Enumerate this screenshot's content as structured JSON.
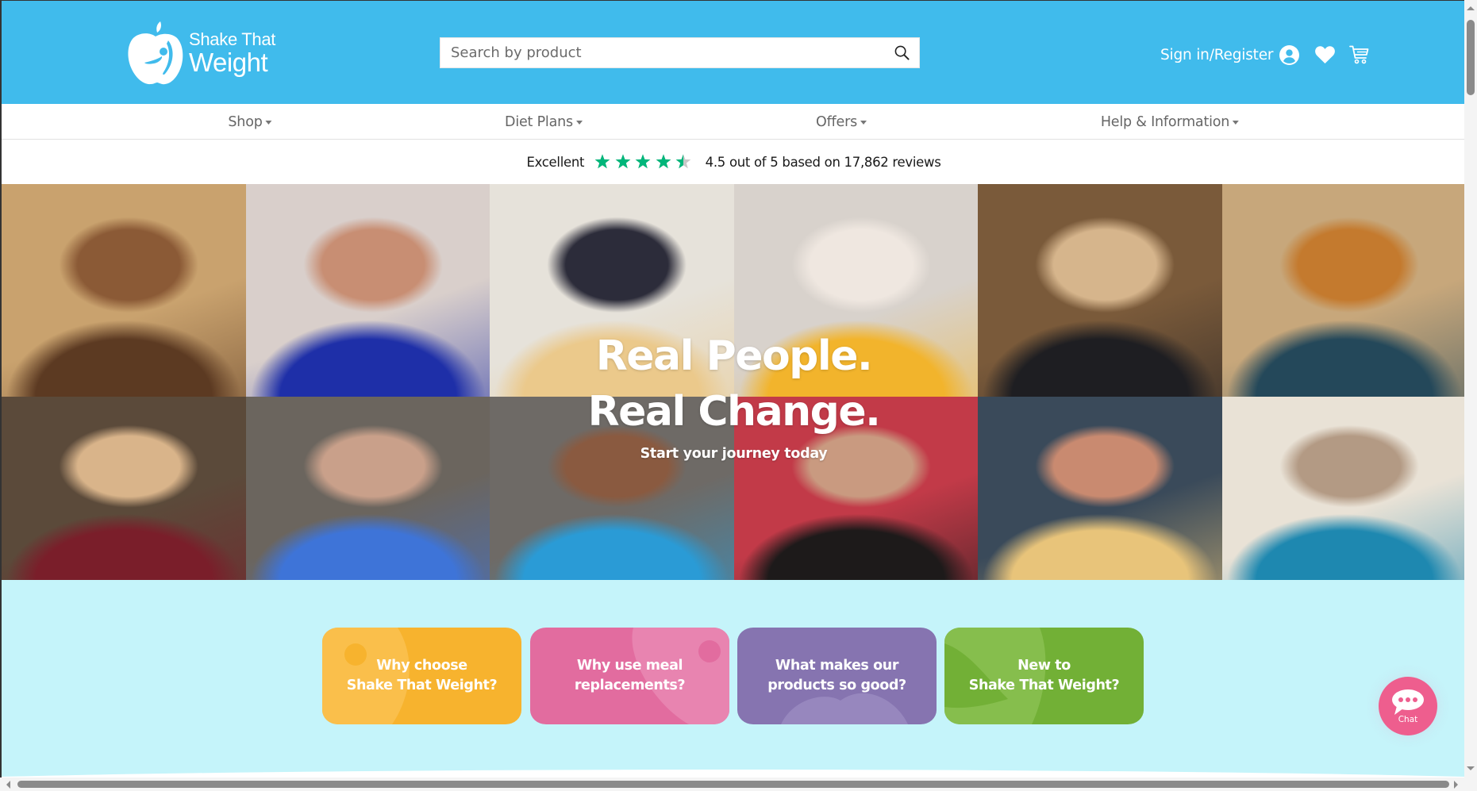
{
  "header": {
    "logo": {
      "line1": "Shake That",
      "line2": "Weight"
    },
    "search": {
      "placeholder": "Search by product",
      "value": ""
    },
    "account": {
      "signin_label": "Sign in/Register"
    }
  },
  "nav": {
    "items": [
      {
        "label": "Shop"
      },
      {
        "label": "Diet Plans"
      },
      {
        "label": "Offers"
      },
      {
        "label": "Help & Information"
      }
    ]
  },
  "trust": {
    "label": "Excellent",
    "rating": 4.5,
    "max_rating": 5,
    "summary": "4.5 out of 5 based on 17,862 reviews",
    "star_color": "#00B67A",
    "star_empty_color": "#C8C8C8"
  },
  "hero": {
    "title_line1": "Real People.",
    "title_line2": "Real Change.",
    "subtitle": "Start your journey today",
    "tiles": [
      {
        "name": "chocolate-bar-photo",
        "palette": [
          "#C9A26E",
          "#5C3A22",
          "#8B5A36"
        ]
      },
      {
        "name": "woman-blue-dress-photo",
        "palette": [
          "#D9CFCB",
          "#1E2FA8",
          "#C88E73"
        ]
      },
      {
        "name": "blonde-woman-necklace-photo",
        "palette": [
          "#E6E2DA",
          "#EBC98B",
          "#2C2C3A"
        ]
      },
      {
        "name": "woman-with-product-box-photo",
        "palette": [
          "#D8D2CC",
          "#F2B42C",
          "#EFE7E0"
        ]
      },
      {
        "name": "woman-mirror-selfie-photo",
        "palette": [
          "#7A5A3A",
          "#1E1E22",
          "#D6B58C"
        ]
      },
      {
        "name": "meal-pouches-photo",
        "palette": [
          "#C7A77B",
          "#24485A",
          "#C47A2E"
        ]
      },
      {
        "name": "woman-straw-hat-photo",
        "palette": [
          "#5B4A3A",
          "#7A1E2A",
          "#D9B48A"
        ]
      },
      {
        "name": "smiling-woman-with-box-photo",
        "palette": [
          "#6B655E",
          "#3E74D8",
          "#C9A08A"
        ]
      },
      {
        "name": "woman-with-shaker-photo",
        "palette": [
          "#6E6A66",
          "#2A9BD6",
          "#8A5A40"
        ]
      },
      {
        "name": "dark-haired-woman-photo",
        "palette": [
          "#C23A48",
          "#1D1A1A",
          "#C99A80"
        ]
      },
      {
        "name": "woman-headband-photo",
        "palette": [
          "#3A4A5A",
          "#E8C47A",
          "#C98A70"
        ]
      },
      {
        "name": "woman-blue-shaker-photo",
        "palette": [
          "#E9E2D6",
          "#1E88B0",
          "#B39A84"
        ]
      }
    ]
  },
  "cta": {
    "cards": [
      {
        "label": "Why choose\nShake That Weight?",
        "color": "#F7B32E",
        "accent": "#F9C04F"
      },
      {
        "label": "Why use meal\nreplacements?",
        "color": "#E26C9F",
        "accent": "#E884B0"
      },
      {
        "label": "What makes our\nproducts so good?",
        "color": "#8674B0",
        "accent": "#9787BE"
      },
      {
        "label": "New to\nShake That Weight?",
        "color": "#72B036",
        "accent": "#86BE4D"
      }
    ]
  },
  "chat": {
    "label": "Chat"
  },
  "colors": {
    "header_bg": "#40BBEC",
    "cta_section_bg": "#C5F4FA",
    "chat_bg": "#EE5E8E"
  }
}
